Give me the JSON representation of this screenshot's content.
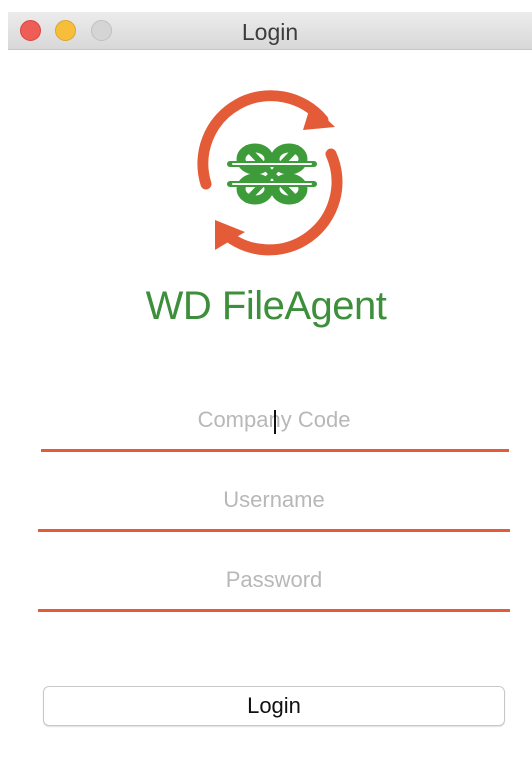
{
  "window": {
    "title": "Login"
  },
  "app": {
    "name": "WD FileAgent",
    "colors": {
      "brand_green": "#3d8f3c",
      "accent_orange": "#e45c37"
    },
    "logo_icon": "sync-arrows-with-green-knot-icon"
  },
  "form": {
    "company_code": {
      "placeholder": "Company Code",
      "value": ""
    },
    "username": {
      "placeholder": "Username",
      "value": ""
    },
    "password": {
      "placeholder": "Password",
      "value": ""
    },
    "login_label": "Login"
  }
}
